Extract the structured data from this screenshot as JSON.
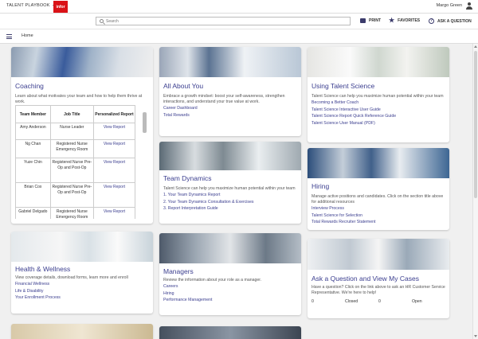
{
  "topbar": {
    "app_name": "TALENT PLAYBOOK",
    "logo": "infor",
    "user_name": "Margo Green"
  },
  "toolbar": {
    "search_placeholder": "Search",
    "print_label": "PRINT",
    "favorites_label": "FAVORITES",
    "ask_label": "ASK A QUESTION"
  },
  "nav": {
    "breadcrumb": "Home"
  },
  "cards": {
    "coaching": {
      "title": "Coaching",
      "desc": "Learn about what motivates your team and how to help them thrive at work.",
      "table": {
        "headers": [
          "Team Member",
          "Job Title",
          "Personalized Report"
        ],
        "rows": [
          {
            "member": "Amy Anderson",
            "title": "Nurse Leader",
            "report": "View Report"
          },
          {
            "member": "Ng Chan",
            "title": "Registered Nurse Emergency Room",
            "report": "View Report"
          },
          {
            "member": "Yuze Chin",
            "title": "Registered Nurse Pre-Op and Post-Op",
            "report": "View Report"
          },
          {
            "member": "Brian Cox",
            "title": "Registered Nurse Pre-Op and Post-Op",
            "report": "View Report"
          },
          {
            "member": "Gabriel Delgado",
            "title": "Registered Nurse Emergency Room",
            "report": "View Report"
          }
        ]
      }
    },
    "all_about_you": {
      "title": "All About You",
      "desc": "Embrace a growth mindset: boost your self-awareness, strengthen interactions, and understand your true value at work.",
      "links": [
        "Career Dashboard",
        "Total Rewards"
      ]
    },
    "using_ts": {
      "title": "Using Talent Science",
      "desc": "Talent Science can help you maximize human potential within your team",
      "links": [
        "Becoming a Better Coach",
        "Talent Science Interactive User Guide",
        "Talent Science Report Quick Reference Guide",
        "Talent Science User Manual (PDF)"
      ]
    },
    "team_dynamics": {
      "title": "Team Dynamics",
      "desc": "Talent Science can help you maximize human potential within your team",
      "links": [
        "1. Your Team Dynamics Report",
        "2. Your Team Dynamics Consultation & Exercises",
        "3. Report Interpretation Guide"
      ]
    },
    "hiring": {
      "title": "Hiring",
      "desc": "Manage active positions and candidates. Click on the section title above for additional resources",
      "links": [
        "Interview Process",
        "Talent Science for Selection",
        "Total Rewards Recruiter Statement"
      ]
    },
    "health": {
      "title": "Health & Wellness",
      "desc": "View coverage details, download forms, learn more and enroll",
      "links": [
        "Financial Wellness",
        "Life & Disability",
        "Your Enrollment Process"
      ]
    },
    "managers": {
      "title": "Managers",
      "desc": "Review the information about your role as a manager.",
      "links": [
        "Careers",
        "Hiring",
        "Performance Management"
      ]
    },
    "ask": {
      "title": "Ask a Question and View My Cases",
      "desc": "Have a question? Click on the link above to ask an HR Customer Service Representative. We're here to help!",
      "stats": [
        "0",
        "Closed",
        "0",
        "Open"
      ]
    }
  },
  "colors": {
    "accent": "#3b3e8f",
    "brand": "#da1217"
  }
}
